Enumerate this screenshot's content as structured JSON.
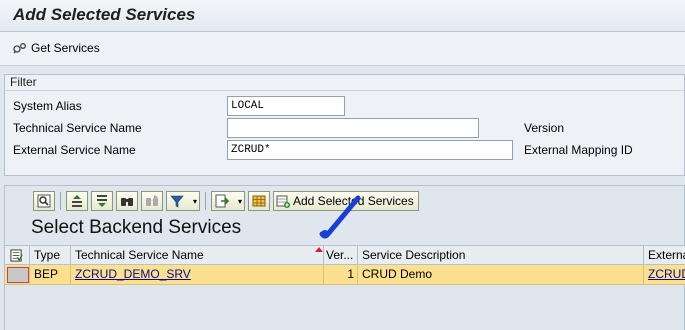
{
  "title": "Add Selected Services",
  "app_toolbar": {
    "get_services": "Get Services"
  },
  "filter": {
    "header": "Filter",
    "system_alias": {
      "label": "System Alias",
      "value": "LOCAL"
    },
    "technical_service_name": {
      "label": "Technical Service Name",
      "value": ""
    },
    "external_service_name": {
      "label": "External Service Name",
      "value": "ZCRUD*"
    },
    "version_label": "Version",
    "external_mapping_id_label": "External Mapping ID"
  },
  "toolbar": {
    "add_selected_services": "Add Selected Services"
  },
  "section_title": "Select Backend Services",
  "table": {
    "columns": [
      "Type",
      "Technical Service Name",
      "Ver...",
      "Service Description",
      "Externa"
    ],
    "rows": [
      {
        "type": "BEP",
        "technical_service_name": "ZCRUD_DEMO_SRV",
        "version": "1",
        "service_description": "CRUD Demo",
        "external": "ZCRUD"
      }
    ]
  },
  "colors": {
    "row_highlight": "#fbe08f",
    "check_mark": "#1a3fd6"
  }
}
